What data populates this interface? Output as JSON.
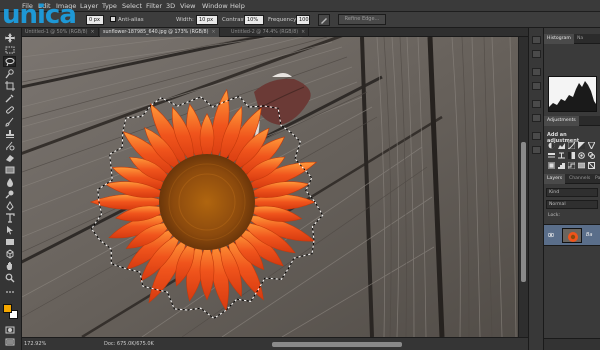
{
  "app": {
    "logo_text": "unica",
    "menu": [
      "File",
      "Edit",
      "Image",
      "Layer",
      "Type",
      "Select",
      "Filter",
      "3D",
      "View",
      "Window",
      "Help"
    ]
  },
  "options": {
    "feather_value": "0 px",
    "anti_alias_label": "Anti-alias",
    "width_label": "Width:",
    "width_value": "10 px",
    "contrast_label": "Contrast:",
    "contrast_value": "10%",
    "frequency_label": "Frequency:",
    "frequency_value": "100",
    "refine_edge_label": "Refine Edge..."
  },
  "tabs": [
    {
      "label": "Untitled-1 @ 50% (RGB/8)",
      "active": false
    },
    {
      "label": "sunflower-187985_640.jpg @ 173% (RGB/8)",
      "active": true
    },
    {
      "label": "Untitled-2 @ 74.4% (RGB/8)",
      "active": false
    }
  ],
  "status": {
    "zoom": "172.92%",
    "doc_size": "Doc: 675.0K/675.0K"
  },
  "panels": {
    "histogram_tab": "Histogram",
    "navigator_tab": "Na",
    "adjustments_tab": "Adjustments",
    "add_adjustment": "Add an adjustment",
    "layers_tab": "Layers",
    "channels_tab": "Channels",
    "paths_tab": "Paths",
    "kind_label": "Kind",
    "blend_mode": "Normal",
    "lock_label": "Lock:",
    "layer_name": "Ba"
  },
  "colors": {
    "logo_blue": "#1e98d6",
    "foreground_swatch": "#f6a800",
    "background_swatch": "#ffffff",
    "petal_orange": "#f0541c",
    "flower_center": "#9a5410"
  }
}
